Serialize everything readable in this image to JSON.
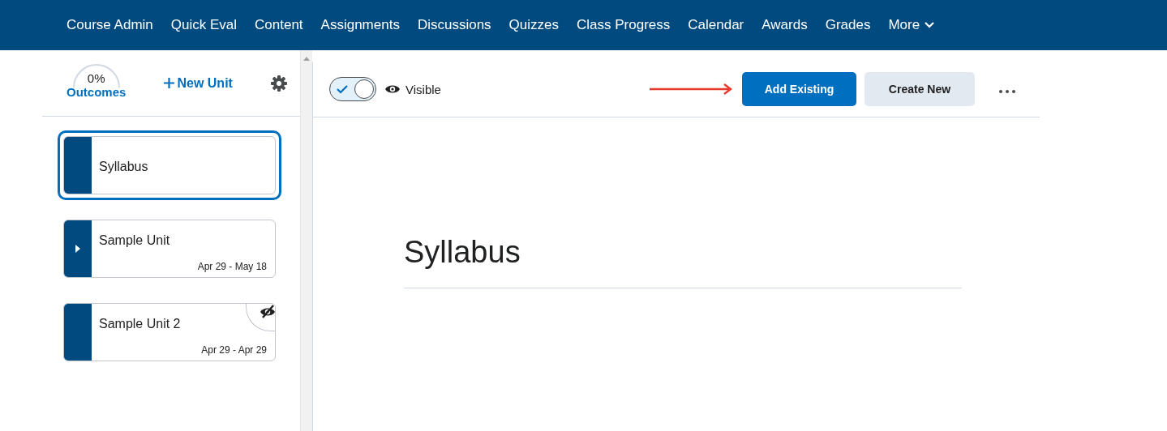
{
  "nav": {
    "items": [
      "Course Admin",
      "Quick Eval",
      "Content",
      "Assignments",
      "Discussions",
      "Quizzes",
      "Class Progress",
      "Calendar",
      "Awards",
      "Grades"
    ],
    "more": "More"
  },
  "sidebar": {
    "outcomes": {
      "percent": "0%",
      "label": "Outcomes"
    },
    "new_unit": "New Unit",
    "units": [
      {
        "title": "Syllabus",
        "selected": true,
        "has_children": false,
        "hidden": false
      },
      {
        "title": "Sample Unit",
        "dates": "Apr 29 - May 18",
        "selected": false,
        "has_children": true,
        "hidden": false
      },
      {
        "title": "Sample Unit 2",
        "dates": "Apr 29 - Apr 29",
        "selected": false,
        "has_children": false,
        "hidden": true
      }
    ]
  },
  "toolbar": {
    "visible_toggle": {
      "on": true,
      "label": "Visible"
    },
    "buttons": [
      {
        "label": "Add Existing",
        "kind": "primary"
      },
      {
        "label": "Create New",
        "kind": "secondary"
      }
    ]
  },
  "content": {
    "title": "Syllabus"
  }
}
